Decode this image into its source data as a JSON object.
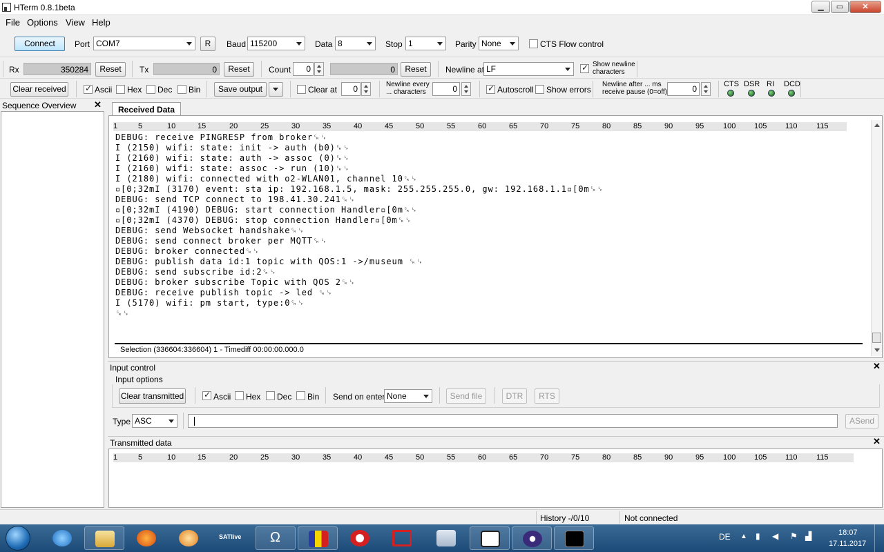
{
  "window": {
    "title": "HTerm 0.8.1beta",
    "min": "▁",
    "max": "▭",
    "close": "✕"
  },
  "menu": [
    "File",
    "Options",
    "View",
    "Help"
  ],
  "conn": {
    "connect": "Connect",
    "port_label": "Port",
    "port": "COM7",
    "refresh": "R",
    "baud_label": "Baud",
    "baud": "115200",
    "data_label": "Data",
    "data": "8",
    "stop_label": "Stop",
    "stop": "1",
    "parity_label": "Parity",
    "parity": "None",
    "cts_flow": "CTS Flow control"
  },
  "counters": {
    "rx_label": "Rx",
    "rx": "350284",
    "rx_reset": "Reset",
    "tx_label": "Tx",
    "tx": "0",
    "tx_reset": "Reset",
    "count_label": "Count",
    "count": "0",
    "count_val": "0",
    "count_reset": "Reset",
    "newline_at_label": "Newline at",
    "newline_at": "LF",
    "show_newline_1": "Show newline",
    "show_newline_2": "characters"
  },
  "recv_opts": {
    "clear_received": "Clear received",
    "ascii": "Ascii",
    "hex": "Hex",
    "dec": "Dec",
    "bin": "Bin",
    "save_output": "Save output",
    "clear_at": "Clear at",
    "clear_at_val": "0",
    "newline_every_1": "Newline every",
    "newline_every_2": "... characters",
    "newline_every_val": "0",
    "autoscroll": "Autoscroll",
    "show_errors": "Show errors",
    "newline_after_1": "Newline after ... ms",
    "newline_after_2": "receive pause (0=off)",
    "newline_after_val": "0",
    "leds": [
      "CTS",
      "DSR",
      "RI",
      "DCD"
    ]
  },
  "sequence": {
    "title": "Sequence Overview",
    "close": "✕"
  },
  "received": {
    "tab": "Received Data",
    "ruler": [
      "1",
      "5",
      "10",
      "15",
      "20",
      "25",
      "30",
      "35",
      "40",
      "45",
      "50",
      "55",
      "60",
      "65",
      "70",
      "75",
      "80",
      "85",
      "90",
      "95",
      "100",
      "105",
      "110",
      "115"
    ],
    "lines": [
      "DEBUG: receive PINGRESP from broker␍␊",
      "I (2150) wifi: state: init -> auth (b0)␍␊",
      "I (2160) wifi: state: auth -> assoc (0)␍␊",
      "I (2160) wifi: state: assoc -> run (10)␍␊",
      "I (2180) wifi: connected with o2-WLAN01, channel 10␍␊",
      "▫[0;32mI (3170) event: sta ip: 192.168.1.5, mask: 255.255.255.0, gw: 192.168.1.1▫[0m␍␊",
      "DEBUG: send TCP connect to 198.41.30.241␍␊",
      "▫[0;32mI (4190) DEBUG: start connection Handler▫[0m␍␊",
      "▫[0;32mI (4370) DEBUG: stop connection Handler▫[0m␍␊",
      "DEBUG: send Websocket handshake␍␊",
      "DEBUG: send connect broker per MQTT␍␊",
      "DEBUG: broker connected␍␊",
      "DEBUG: publish data id:1 topic with QOS:1 ->/museum ␍␊",
      "DEBUG: send subscribe id:2␍␊",
      "DEBUG: broker subscribe Topic with QOS 2␍␊",
      "DEBUG: receive publish topic -> led ␍␊",
      "I (5170) wifi: pm start, type:0␍␊",
      "␍␊"
    ],
    "selection": "Selection (336604:336604) 1  -  Timediff 00:00:00.000.0"
  },
  "input": {
    "title": "Input control",
    "close": "✕",
    "options_title": "Input options",
    "clear_transmitted": "Clear transmitted",
    "ascii": "Ascii",
    "hex": "Hex",
    "dec": "Dec",
    "bin": "Bin",
    "send_on_enter_label": "Send on enter",
    "send_on_enter": "None",
    "send_file": "Send file",
    "dtr": "DTR",
    "rts": "RTS",
    "type_label": "Type",
    "type": "ASC",
    "value": "",
    "asend": "ASend"
  },
  "transmitted": {
    "title": "Transmitted data",
    "close": "✕",
    "ruler": [
      "1",
      "5",
      "10",
      "15",
      "20",
      "25",
      "30",
      "35",
      "40",
      "45",
      "50",
      "55",
      "60",
      "65",
      "70",
      "75",
      "80",
      "85",
      "90",
      "95",
      "100",
      "105",
      "110",
      "115"
    ]
  },
  "status": {
    "history": "History -/0/10",
    "connection": "Not connected"
  },
  "taskbar": {
    "lang": "DE",
    "time": "18:07",
    "date": "17.11.2017",
    "satlive": "SATlive",
    "omega": "Ω"
  }
}
